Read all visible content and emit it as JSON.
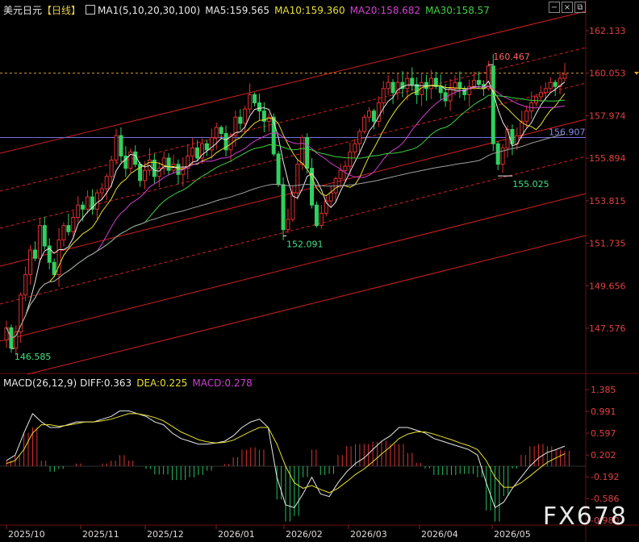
{
  "header": {
    "symbol": "美元日元",
    "period": "【日线】",
    "ma_params": "MA1(5,10,20,30,100)",
    "ma5": "MA5:159.565",
    "ma10": "MA10:159.360",
    "ma20": "MA20:158.682",
    "ma30": "MA30:158.57",
    "colors": {
      "symbol": "#e8e8e8",
      "period": "#e8d040",
      "ma5": "#e8e8e8",
      "ma10": "#e8e030",
      "ma20": "#d040d0",
      "ma30": "#40d040"
    }
  },
  "window_buttons": [
    {
      "icon": "minus-icon",
      "glyph": "−"
    },
    {
      "icon": "close-icon",
      "glyph": "×"
    },
    {
      "icon": "maximize-icon",
      "glyph": "⧉"
    }
  ],
  "macd_header": {
    "params": "MACD(26,12,9)",
    "diff": "DIFF:0.363",
    "dea": "DEA:0.225",
    "macd": "MACD:0.278"
  },
  "watermark": "FX678",
  "chart_data": [
    {
      "type": "candlestick",
      "title": "美元日元【日线】",
      "ylim": [
        145.8,
        163.0
      ],
      "y_ticks": [
        "162.133",
        "160.053",
        "157.974",
        "155.894",
        "153.815",
        "151.735",
        "149.656",
        "147.576"
      ],
      "x_ticks": [
        "2025/10",
        "2025/11",
        "2025/12",
        "2026/01",
        "2026/02",
        "2026/03",
        "2026/04",
        "2026/05"
      ],
      "annotations": [
        {
          "text": "160.467",
          "value": 160.467,
          "kind": "high"
        },
        {
          "text": "155.025",
          "value": 155.025,
          "kind": "low"
        },
        {
          "text": "152.091",
          "value": 152.091,
          "kind": "low"
        },
        {
          "text": "146.585",
          "value": 146.585,
          "kind": "low"
        }
      ],
      "hline_value": 156.907,
      "hline_label": "156.907",
      "dashed_level": 160.053,
      "close_series_approx": [
        147.6,
        146.6,
        147.4,
        149.2,
        150.2,
        151.4,
        151.0,
        152.6,
        151.6,
        150.8,
        150.2,
        151.9,
        152.6,
        152.3,
        153.0,
        153.6,
        153.4,
        154.0,
        153.4,
        154.2,
        154.4,
        155.0,
        155.8,
        157.0,
        156.0,
        155.4,
        156.2,
        155.6,
        154.8,
        155.3,
        155.8,
        155.0,
        155.4,
        155.9,
        155.3,
        155.6,
        155.1,
        155.4,
        156.0,
        156.4,
        155.9,
        156.6,
        156.3,
        156.9,
        157.4,
        157.1,
        156.3,
        157.0,
        157.9,
        157.6,
        158.3,
        159.0,
        158.6,
        158.2,
        157.7,
        157.9,
        156.1,
        154.6,
        152.4,
        152.9,
        154.2,
        155.6,
        156.9,
        155.4,
        153.6,
        152.6,
        153.2,
        153.8,
        154.2,
        154.9,
        155.3,
        155.5,
        156.2,
        156.6,
        157.2,
        157.9,
        158.2,
        157.7,
        158.6,
        159.3,
        159.6,
        159.1,
        159.6,
        159.3,
        159.8,
        159.5,
        159.0,
        159.6,
        159.3,
        159.8,
        159.4,
        159.1,
        158.7,
        159.3,
        159.6,
        159.3,
        159.0,
        159.4,
        159.7,
        159.5,
        159.3,
        160.4,
        156.6,
        155.6,
        156.4,
        157.3,
        156.6,
        157.0,
        157.7,
        158.2,
        158.6,
        158.9,
        159.1,
        159.3,
        159.6,
        159.4,
        159.8,
        160.0
      ],
      "overlays": [
        "MA5",
        "MA10",
        "MA20",
        "MA30",
        "MA100",
        "channel lines"
      ]
    },
    {
      "type": "bar",
      "title": "MACD(26,12,9)",
      "ylim": [
        -1.05,
        1.4
      ],
      "y_ticks": [
        "1.385",
        "0.991",
        "0.597",
        "0.202",
        "-0.192",
        "-0.586",
        "-0.980"
      ],
      "series": [
        {
          "name": "DIFF",
          "color": "#e8e8e8",
          "values": [
            0.1,
            0.2,
            0.6,
            0.95,
            0.8,
            0.7,
            0.7,
            0.75,
            0.8,
            0.8,
            0.8,
            0.85,
            0.9,
            1.0,
            1.0,
            0.95,
            0.9,
            0.8,
            0.75,
            0.6,
            0.5,
            0.45,
            0.4,
            0.4,
            0.42,
            0.45,
            0.55,
            0.7,
            0.8,
            0.85,
            0.7,
            -0.2,
            -0.7,
            -0.75,
            -0.5,
            -0.2,
            -0.5,
            -0.55,
            -0.3,
            -0.1,
            0.05,
            0.15,
            0.3,
            0.45,
            0.55,
            0.7,
            0.7,
            0.65,
            0.6,
            0.5,
            0.45,
            0.4,
            0.35,
            0.3,
            0.2,
            -0.3,
            -0.75,
            -0.65,
            -0.4,
            -0.2,
            0.0,
            0.15,
            0.25,
            0.3,
            0.363
          ]
        },
        {
          "name": "DEA",
          "color": "#e8e030",
          "values": [
            0.05,
            0.1,
            0.3,
            0.6,
            0.75,
            0.75,
            0.72,
            0.74,
            0.77,
            0.8,
            0.8,
            0.82,
            0.85,
            0.9,
            0.95,
            0.95,
            0.92,
            0.88,
            0.82,
            0.72,
            0.62,
            0.55,
            0.48,
            0.44,
            0.42,
            0.43,
            0.47,
            0.55,
            0.63,
            0.7,
            0.7,
            0.4,
            0.0,
            -0.3,
            -0.4,
            -0.35,
            -0.42,
            -0.48,
            -0.4,
            -0.28,
            -0.15,
            -0.05,
            0.08,
            0.22,
            0.35,
            0.5,
            0.58,
            0.62,
            0.62,
            0.58,
            0.53,
            0.48,
            0.42,
            0.37,
            0.3,
            0.1,
            -0.2,
            -0.38,
            -0.38,
            -0.3,
            -0.18,
            -0.05,
            0.07,
            0.15,
            0.225
          ]
        },
        {
          "name": "MACD",
          "color": "#e04040",
          "values": [
            0.1,
            0.2,
            0.6,
            0.7,
            0.1,
            -0.1,
            -0.05,
            0.0,
            0.05,
            0.0,
            0.0,
            0.05,
            0.1,
            0.2,
            0.1,
            0.0,
            -0.05,
            -0.15,
            -0.15,
            -0.25,
            -0.25,
            -0.2,
            -0.16,
            -0.08,
            0.0,
            0.04,
            0.16,
            0.3,
            0.34,
            0.3,
            0.0,
            -0.6,
            -1.0,
            -0.9,
            -0.2,
            0.3,
            -0.16,
            -0.14,
            0.2,
            0.36,
            0.4,
            0.4,
            0.44,
            0.46,
            0.4,
            0.4,
            0.24,
            0.06,
            -0.04,
            -0.16,
            -0.16,
            -0.16,
            -0.14,
            -0.14,
            -0.2,
            -0.8,
            -1.0,
            -0.54,
            -0.04,
            0.2,
            0.36,
            0.4,
            0.36,
            0.3,
            0.278
          ]
        }
      ]
    }
  ]
}
